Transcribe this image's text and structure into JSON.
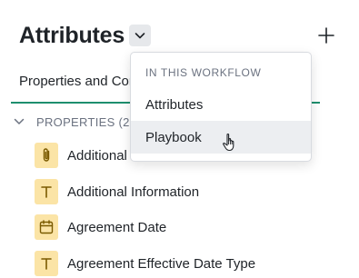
{
  "header": {
    "title": "Attributes",
    "chevron_icon": "chevron-down-icon",
    "add_icon": "plus-icon"
  },
  "tabs": [
    {
      "label": "Properties and Con"
    }
  ],
  "section": {
    "label": "PROPERTIES (2",
    "icon": "chevron-down-icon"
  },
  "rows": [
    {
      "label": "Additional",
      "icon": "paperclip-icon"
    },
    {
      "label": "Additional Information",
      "icon": "text-type-icon"
    },
    {
      "label": "Agreement Date",
      "icon": "calendar-icon"
    },
    {
      "label": "Agreement Effective Date Type",
      "icon": "text-type-icon"
    }
  ],
  "dropdown": {
    "heading": "IN THIS WORKFLOW",
    "items": [
      {
        "label": "Attributes"
      },
      {
        "label": "Playbook",
        "hovered": true
      }
    ]
  },
  "colors": {
    "accent": "#1e8f6e",
    "icon_bg": "#fbe4a6",
    "icon_fg": "#7a5a00"
  }
}
